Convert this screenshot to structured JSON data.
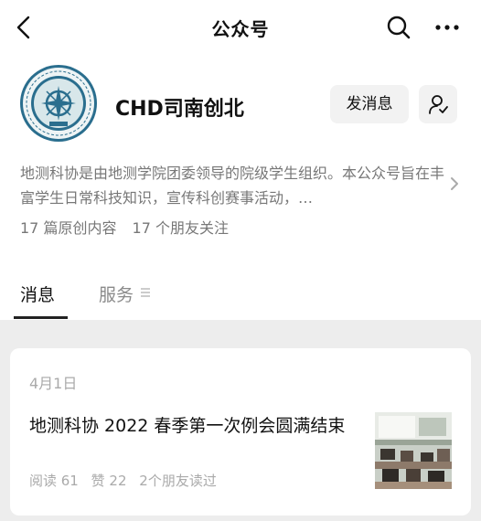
{
  "nav": {
    "title": "公众号"
  },
  "account": {
    "name": "CHD司南创北",
    "message_button": "发消息",
    "description": "地测科协是由地测学院团委领导的院级学生组织。本公众号旨在丰富学生日常科技知识，宣传科创赛事活动，…",
    "stats": {
      "originals": "17 篇原创内容",
      "friends": "17 个朋友关注"
    }
  },
  "tabs": {
    "messages": "消息",
    "services": "服务"
  },
  "article": {
    "date": "4月1日",
    "title": "地测科协 2022 春季第一次例会圆满结束",
    "reads": "阅读 61",
    "likes": "赞 22",
    "friends_read": "2个朋友读过"
  },
  "colors": {
    "logo_ring": "#2a6e8e",
    "logo_fill": "#d8e7ea",
    "text_muted": "#777777"
  },
  "icons": [
    "back-icon",
    "search-icon",
    "more-icon",
    "profile-icon",
    "chevron-right-icon",
    "menu-icon"
  ]
}
